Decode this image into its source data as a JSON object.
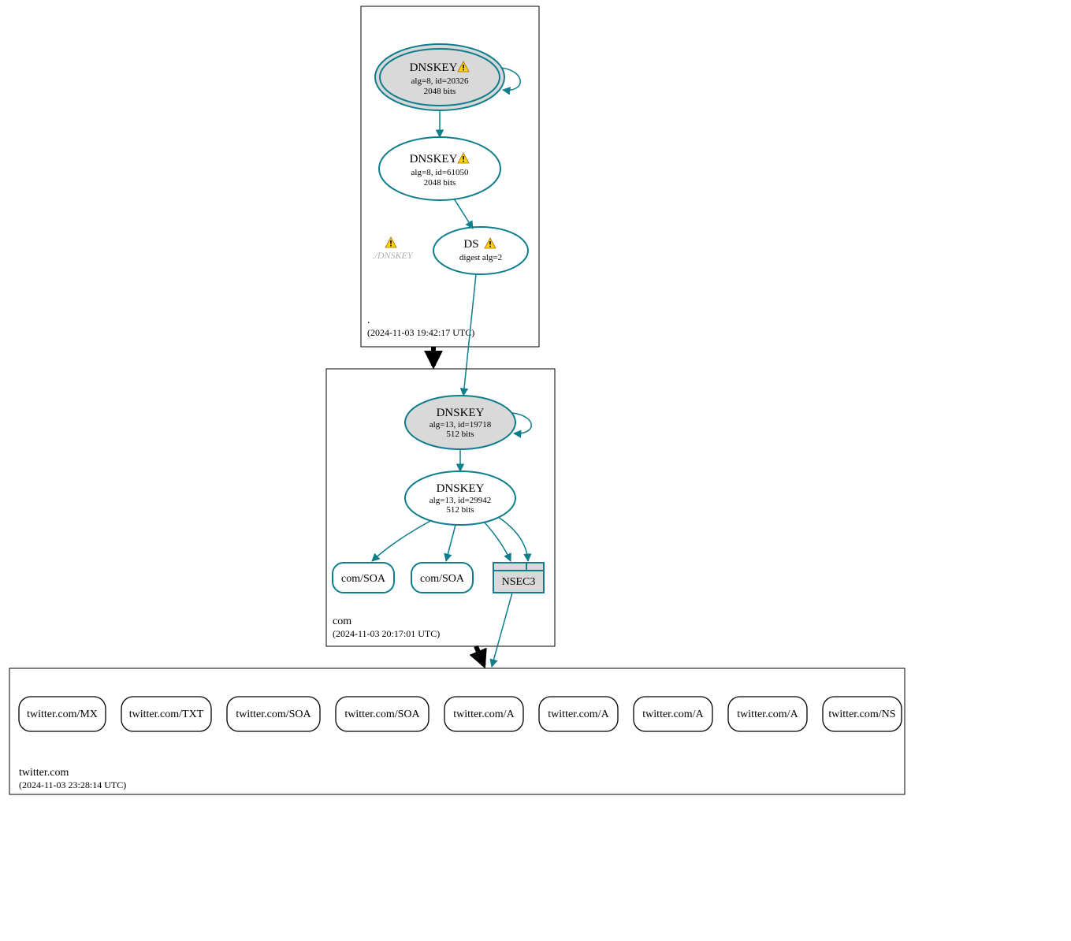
{
  "colors": {
    "teal": "#0e7d8c",
    "gray_fill": "#d9d9d9",
    "black": "#000000"
  },
  "zones": {
    "root": {
      "label": ".",
      "timestamp": "(2024-11-03 19:42:17 UTC)"
    },
    "com": {
      "label": "com",
      "timestamp": "(2024-11-03 20:17:01 UTC)"
    },
    "twitter": {
      "label": "twitter.com",
      "timestamp": "(2024-11-03 23:28:14 UTC)"
    }
  },
  "nodes": {
    "root_ksk": {
      "title": "DNSKEY",
      "line2": "alg=8, id=20326",
      "line3": "2048 bits",
      "warn": true
    },
    "root_zsk": {
      "title": "DNSKEY",
      "line2": "alg=8, id=61050",
      "line3": "2048 bits",
      "warn": true
    },
    "root_ds": {
      "title": "DS",
      "line2": "digest alg=2",
      "warn": true
    },
    "root_ghost": {
      "label": "./DNSKEY"
    },
    "com_ksk": {
      "title": "DNSKEY",
      "line2": "alg=13, id=19718",
      "line3": "512 bits"
    },
    "com_zsk": {
      "title": "DNSKEY",
      "line2": "alg=13, id=29942",
      "line3": "512 bits"
    },
    "com_soa1": {
      "label": "com/SOA"
    },
    "com_soa2": {
      "label": "com/SOA"
    },
    "com_nsec3": {
      "label": "NSEC3"
    }
  },
  "rrsets": {
    "r0": "twitter.com/MX",
    "r1": "twitter.com/TXT",
    "r2": "twitter.com/SOA",
    "r3": "twitter.com/SOA",
    "r4": "twitter.com/A",
    "r5": "twitter.com/A",
    "r6": "twitter.com/A",
    "r7": "twitter.com/A",
    "r8": "twitter.com/NS"
  }
}
